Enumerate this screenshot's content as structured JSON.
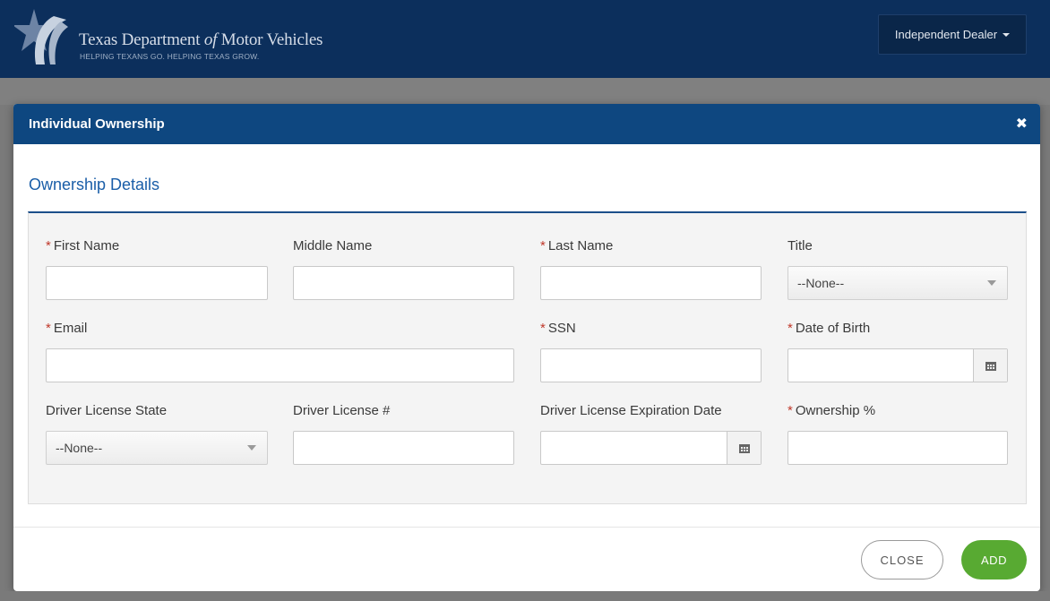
{
  "header": {
    "brand_title_pre": "Texas Department ",
    "brand_title_of": "of",
    "brand_title_post": " Motor Vehicles",
    "tagline": "HELPING TEXANS GO. HELPING TEXAS GROW.",
    "user_menu_label": "Independent Dealer",
    "logo_icon": "star-flag-icon"
  },
  "modal": {
    "title": "Individual Ownership",
    "close_glyph": "✖",
    "section_title": "Ownership Details",
    "required_marker": "*",
    "fields": {
      "first_name": {
        "label": "First Name",
        "required": true,
        "value": ""
      },
      "middle_name": {
        "label": "Middle Name",
        "required": false,
        "value": ""
      },
      "last_name": {
        "label": "Last Name",
        "required": true,
        "value": ""
      },
      "title": {
        "label": "Title",
        "required": false,
        "selected": "--None--"
      },
      "email": {
        "label": "Email",
        "required": true,
        "value": ""
      },
      "ssn": {
        "label": "SSN",
        "required": true,
        "value": ""
      },
      "date_of_birth": {
        "label": "Date of Birth",
        "required": true,
        "value": ""
      },
      "dl_state": {
        "label": "Driver License State",
        "required": false,
        "selected": "--None--"
      },
      "dl_number": {
        "label": "Driver License #",
        "required": false,
        "value": ""
      },
      "dl_expiration": {
        "label": "Driver License Expiration Date",
        "required": false,
        "value": ""
      },
      "ownership_pct": {
        "label": "Ownership %",
        "required": true,
        "value": ""
      }
    },
    "buttons": {
      "close_label": "CLOSE",
      "add_label": "ADD"
    }
  },
  "colors": {
    "topbar": "#0c2f5c",
    "modal_header": "#0e4780",
    "section_title": "#1a5ea8",
    "add_button": "#58aa32",
    "required": "#c0392b"
  }
}
